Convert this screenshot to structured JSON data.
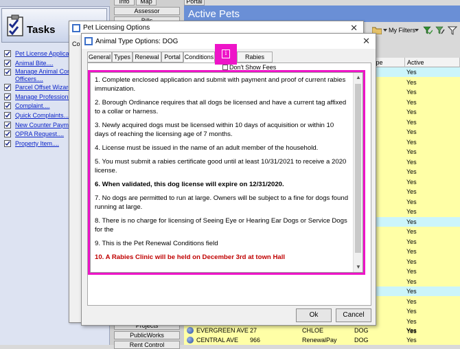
{
  "tasks": {
    "title": "Tasks",
    "items": [
      {
        "label": "Pet License Applicati..."
      },
      {
        "label": "Animal Bite...."
      },
      {
        "label": "Manage Animal Control Officers...."
      },
      {
        "label": "Parcel Offset Wizard...."
      },
      {
        "label": "Manage Professionals...."
      },
      {
        "label": "Complaint...."
      },
      {
        "label": "Quick Complaints...."
      },
      {
        "label": "New Counter Payment...."
      },
      {
        "label": "OPRA Request...."
      },
      {
        "label": "Property Item...."
      }
    ]
  },
  "nav": {
    "top_tabs": [
      "Info",
      "Map",
      "Portal"
    ],
    "assessor": "Assessor",
    "bills": "Bills",
    "projects": "Projects",
    "public_works": "PublicWorks",
    "more": "Rent Control"
  },
  "active_pets": {
    "title": "Active Pets",
    "my_filters": "My Filters",
    "columns": [
      "ype",
      "Active"
    ],
    "rows": [
      {
        "active": "Yes"
      },
      {
        "active": "Yes"
      },
      {
        "active": "Yes"
      },
      {
        "active": "Yes"
      },
      {
        "active": "Yes"
      },
      {
        "active": "Yes"
      },
      {
        "active": "Yes"
      },
      {
        "active": "Yes"
      },
      {
        "active": "Yes"
      },
      {
        "active": "Yes"
      },
      {
        "active": "Yes"
      },
      {
        "active": "Yes"
      },
      {
        "active": "Yes"
      },
      {
        "active": "Yes"
      },
      {
        "active": "Yes"
      },
      {
        "active": "Yes"
      },
      {
        "active": "Yes"
      },
      {
        "active": "Yes"
      },
      {
        "active": "Yes"
      },
      {
        "active": "Yes"
      },
      {
        "active": "Yes"
      },
      {
        "active": "Yes"
      },
      {
        "active": "Yes"
      },
      {
        "active": "Yes"
      },
      {
        "active": "Yes"
      },
      {
        "active": "Yes"
      },
      {
        "active": "Yes"
      }
    ],
    "bottom_rows": [
      {
        "street": "EVERGREEN AVE",
        "num": "27",
        "name": "CHLOE",
        "type": "DOG",
        "active": "Yes"
      },
      {
        "street": "CENTRAL AVE",
        "num": "966",
        "name": "RenewalPay",
        "type": "DOG",
        "active": "Yes"
      }
    ]
  },
  "pet_licensing": {
    "title": "Pet Licensing Options",
    "partial_label": "Co"
  },
  "animal_type": {
    "title": "Animal Type Options: DOG",
    "tabs": [
      "General",
      "Types",
      "Renewal",
      "Portal",
      "Conditions",
      "Rabies Clinic"
    ],
    "active_tab": "Conditions",
    "dont_show_fees": "Don't Show Fees",
    "conditions": [
      "1.  Complete enclosed application and submit with payment and proof of current rabies immunization.",
      "2.  Borough Ordinance requires that all dogs be licensed and have a current tag affixed to a collar or harness.",
      "3.  Newly acquired dogs must be licensed within 10 days of acquisition or within 10 days of reaching the licensing age of 7 months.",
      "4.  License must be issued in the name of an adult member of the household.",
      "5.  You must submit a rabies certificate good until at least 10/31/2021 to receive a 2020 license.",
      "6.  When validated, this dog license will expire on 12/31/2020.",
      "7.  No dogs are permitted to run at large. Owners will be subject to a fine for dogs found running at large.",
      "8.  There is no charge for licensing of Seeing Eye or Hearing Ear Dogs or Service Dogs for the",
      "9. This is the Pet Renewal Conditions field",
      "10. A Rabies Clinic will be held on December 3rd at town Hall"
    ],
    "ok_label": "Ok",
    "cancel_label": "Cancel"
  },
  "annotation": {
    "highlight_color": "#ee14c8",
    "marker_icon": "info-icon",
    "marker_glyph": "i"
  }
}
